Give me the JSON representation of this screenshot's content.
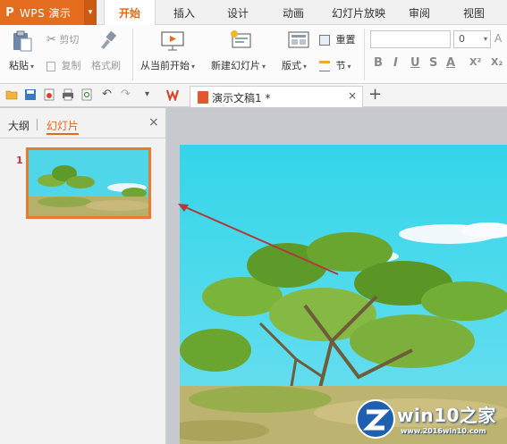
{
  "app": {
    "logo": "P",
    "name": "WPS 演示",
    "brand_color": "#e46c1e"
  },
  "tabs": [
    {
      "label": "开始",
      "active": true
    },
    {
      "label": "插入",
      "active": false
    },
    {
      "label": "设计",
      "active": false
    },
    {
      "label": "动画",
      "active": false
    },
    {
      "label": "幻灯片放映",
      "active": false
    },
    {
      "label": "审阅",
      "active": false
    },
    {
      "label": "视图",
      "active": false
    }
  ],
  "ribbon": {
    "paste": "粘贴",
    "cut": "剪切",
    "copy": "复制",
    "format_painter": "格式刷",
    "from_current": "从当前开始",
    "new_slide": "新建幻灯片",
    "layout": "版式",
    "reset": "重置",
    "section": "节",
    "font_size": "0",
    "font_format": {
      "bold": "B",
      "italic": "I",
      "underline": "U",
      "strike": "S",
      "font_color": "A",
      "superscript": "X²",
      "subscript": "X₂"
    }
  },
  "document": {
    "tab_title": "演示文稿1 *",
    "close": "×",
    "new_tab": "+"
  },
  "panel": {
    "tab_outline": "大纲",
    "tab_slides": "幻灯片",
    "close": "×",
    "slide_number": "1"
  },
  "watermark": {
    "title": "win10之家",
    "url": "www.2016win10.com"
  },
  "colors": {
    "accent": "#e2691a",
    "thumb_border": "#e57c32",
    "annotation_arrow": "#b03a3a",
    "sky": "#35d3e8",
    "tree_green": "#5e9a2a"
  }
}
